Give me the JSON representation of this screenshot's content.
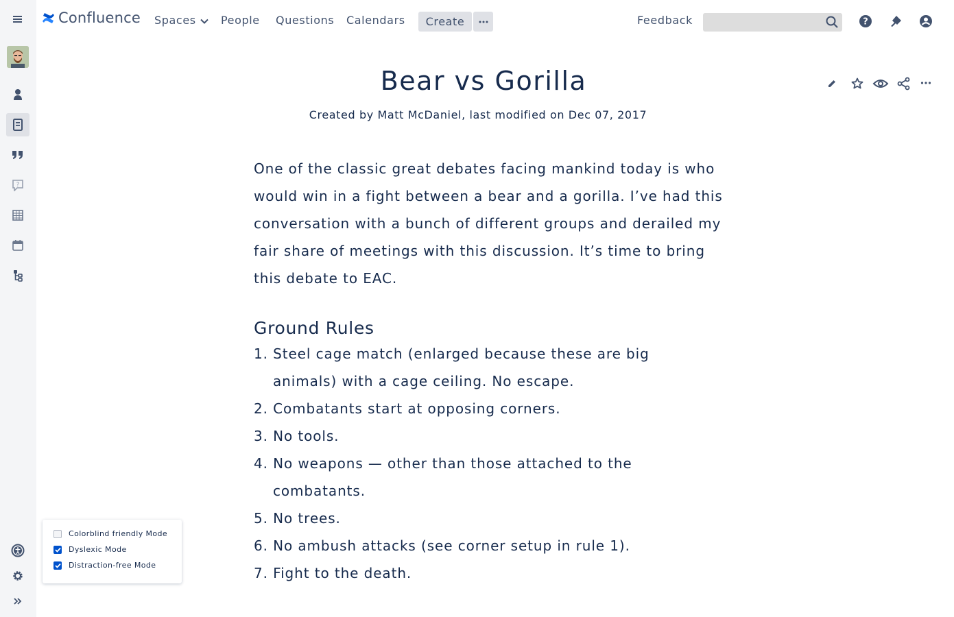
{
  "app": {
    "name": "Confluence",
    "brand_color": "#0052cc"
  },
  "nav": {
    "spaces": "Spaces",
    "people": "People",
    "questions": "Questions",
    "calendars": "Calendars",
    "create": "Create",
    "more": "⋯",
    "feedback": "Feedback",
    "search_placeholder": ""
  },
  "sidebar": {
    "items": [
      {
        "icon": "menu-icon"
      },
      {
        "icon": "avatar"
      },
      {
        "icon": "person-icon"
      },
      {
        "icon": "pages-icon",
        "active": true
      },
      {
        "icon": "quote-icon"
      },
      {
        "icon": "question-icon"
      },
      {
        "icon": "calendar-grid-icon"
      },
      {
        "icon": "calendar-icon"
      },
      {
        "icon": "hierarchy-icon"
      },
      {
        "icon": "accessibility-icon"
      },
      {
        "icon": "gear-icon"
      },
      {
        "icon": "expand-icon"
      }
    ]
  },
  "page": {
    "title": "Bear vs Gorilla",
    "byline": "Created by Matt McDaniel, last modified on Dec 07, 2017",
    "intro": "One of the classic great debates facing mankind today is who would win in a fight between a bear and a gorilla. I’ve had this conversation with a bunch of different groups and derailed my fair share of meetings with this discussion. It’s time to bring this debate to EAC.",
    "section_heading": "Ground Rules",
    "rules": [
      "1. Steel cage match (enlarged because these are big animals) with a cage ceiling. No escape.",
      "2. Combatants start at opposing corners.",
      "3. No tools.",
      "4. No weapons — other than those attached to the combatants.",
      "5. No trees.",
      "6. No ambush attacks (see corner setup in rule 1).",
      "7. Fight to the death."
    ]
  },
  "a11y_panel": {
    "options": [
      {
        "label": "Colorblind friendly Mode",
        "checked": false
      },
      {
        "label": "Dyslexic Mode",
        "checked": true
      },
      {
        "label": "Distraction-free Mode",
        "checked": true
      }
    ]
  }
}
